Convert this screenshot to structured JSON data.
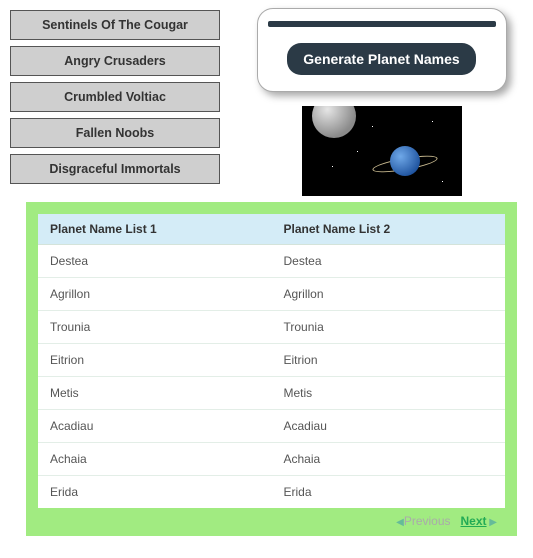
{
  "left_buttons": [
    "Sentinels Of The Cougar",
    "Angry Crusaders",
    "Crumbled Voltiac",
    "Fallen Noobs",
    "Disgraceful Immortals"
  ],
  "panel": {
    "generate_label": "Generate Planet Names"
  },
  "table": {
    "header1": "Planet Name List 1",
    "header2": "Planet Name List 2",
    "rows": [
      {
        "c1": "Destea",
        "c2": "Destea"
      },
      {
        "c1": "Agrillon",
        "c2": "Agrillon"
      },
      {
        "c1": "Trounia",
        "c2": "Trounia"
      },
      {
        "c1": "Eitrion",
        "c2": "Eitrion"
      },
      {
        "c1": "Metis",
        "c2": "Metis"
      },
      {
        "c1": "Acadiau",
        "c2": "Acadiau"
      },
      {
        "c1": "Achaia",
        "c2": "Achaia"
      },
      {
        "c1": "Erida",
        "c2": "Erida"
      }
    ]
  },
  "pager": {
    "previous": "Previous",
    "next": "Next"
  }
}
